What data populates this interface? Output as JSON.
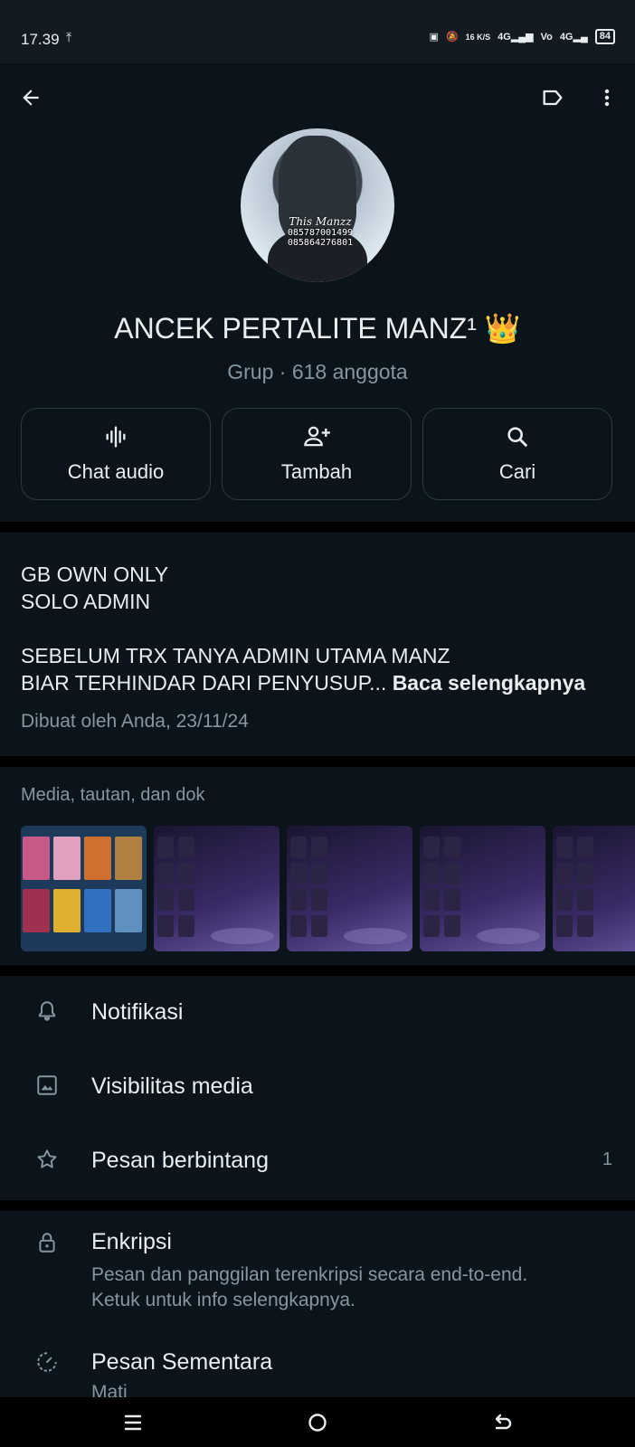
{
  "status_bar": {
    "time": "17.39",
    "upload_icon": "upload-icon",
    "net_speed": "16 K/S",
    "battery": "84"
  },
  "group": {
    "name": "ANCEK PERTALITE MANZ¹ 👑",
    "subtitle": "Grup · 618 anggota",
    "avatar_watermark_signature": "This Manzz",
    "avatar_watermark_line1": "085787001499",
    "avatar_watermark_line2": "085864276801"
  },
  "actions": [
    {
      "label": "Chat audio",
      "icon": "audio-waveform-icon"
    },
    {
      "label": "Tambah",
      "icon": "add-person-icon"
    },
    {
      "label": "Cari",
      "icon": "search-icon"
    }
  ],
  "description": {
    "line1": "GB OWN ONLY",
    "line2": "SOLO ADMIN",
    "line3": "SEBELUM TRX TANYA ADMIN UTAMA MANZ",
    "line4": "BIAR TERHINDAR DARI PENYUSUP...",
    "read_more": "Baca selengkapnya",
    "created": "Dibuat oleh Anda, 23/11/24"
  },
  "media": {
    "title": "Media, tautan, dan dok"
  },
  "menu": {
    "notifications": "Notifikasi",
    "media_visibility": "Visibilitas media",
    "starred": "Pesan berbintang",
    "starred_count": "1",
    "encryption": "Enkripsi",
    "encryption_sub1": "Pesan dan panggilan terenkripsi secara end-to-end.",
    "encryption_sub2": "Ketuk untuk info selengkapnya.",
    "disappearing": "Pesan Sementara",
    "disappearing_sub": "Mati"
  },
  "colors": {
    "background": "#0b141a",
    "text_primary": "#e9edef",
    "text_secondary": "#8696a0",
    "separator": "#000000",
    "button_border": "#2a3942"
  }
}
